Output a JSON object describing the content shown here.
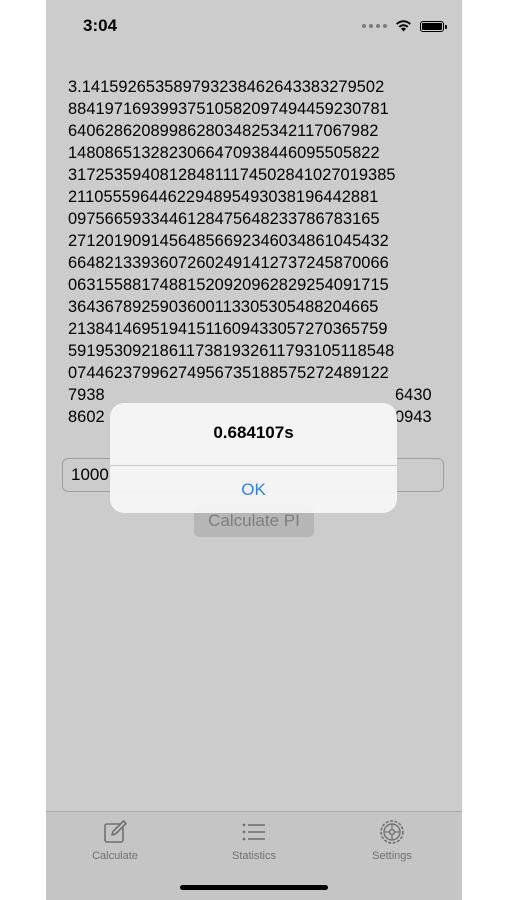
{
  "status_bar": {
    "time": "3:04"
  },
  "pi_digits": [
    "3.1415926535897932384626433832795 02",
    "8841971693993751058209749445923 0781",
    "6406286208998628034825342117067982",
    "1480865132823066470938446095505822",
    "3172535940812848111745028410270193 85",
    "2110555964462294895493038196442881",
    "0975665933446128475648233786783165",
    "2712019091456485669234603486104543 2",
    "6648213393607260249141273724587006 6",
    "0631558817488152092096282925409171 5",
    "3643678925903600113305305488204665",
    "2138414695194151160943305727036575 9",
    "5919530921861173819326117931051185 48",
    "0744623799627495673518857527248912 2",
    "7938",
    "8602"
  ],
  "digit_right_fragments": {
    "line15": "6430",
    "line16": "0943"
  },
  "input": {
    "value": "1000"
  },
  "calculate_button": {
    "label": "Calculate PI"
  },
  "tabs": [
    {
      "label": "Calculate",
      "icon": "compose-icon"
    },
    {
      "label": "Statistics",
      "icon": "list-icon"
    },
    {
      "label": "Settings",
      "icon": "gear-icon"
    }
  ],
  "alert": {
    "title": "0.684107s",
    "ok_label": "OK"
  },
  "colors": {
    "accent": "#2f7ff7",
    "dim_overlay": "rgba(0,0,0,0.20)"
  }
}
